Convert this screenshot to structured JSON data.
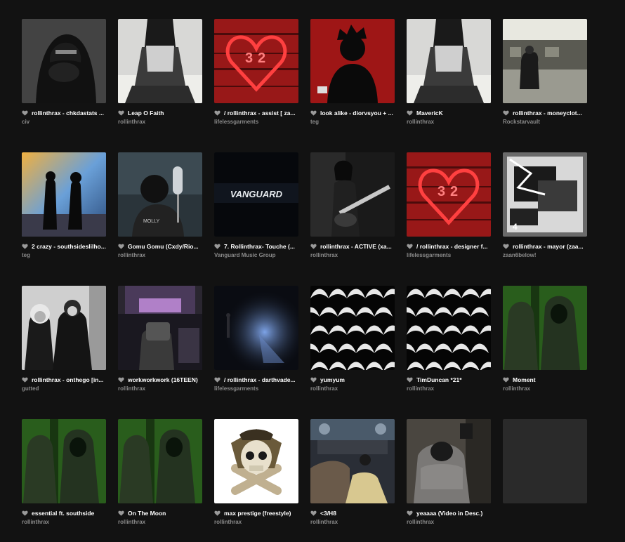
{
  "items": [
    {
      "title": "rollinthrax - chkdastats ...",
      "user": "civ",
      "art": "hooded-figure-photo"
    },
    {
      "title": "Leap O Faith",
      "user": "rollinthrax",
      "art": "figure-on-bed-photo"
    },
    {
      "title": "/ rollinthrax - assist [ za...",
      "user": "lifelessgarments",
      "art": "red-heart-collage"
    },
    {
      "title": "look alike - diorvsyou + ...",
      "user": "teg",
      "art": "red-silhouette-cover"
    },
    {
      "title": "MavericK",
      "user": "rollinthrax",
      "art": "figure-on-bed-photo"
    },
    {
      "title": "rollinthrax - moneyclot...",
      "user": "Rockstarvault",
      "art": "parking-garage-photo"
    },
    {
      "title": "2 crazy - southsideslilho...",
      "user": "teg",
      "art": "two-figures-sky-photo"
    },
    {
      "title": "Gomu Gomu (Cxdy/Rio...",
      "user": "rollinthrax",
      "art": "studio-microphone-photo"
    },
    {
      "title": "7. Rollinthrax- Touche (...",
      "user": "Vanguard Music Group",
      "art": "vanguard-logo-cover"
    },
    {
      "title": "rollinthrax - ACTIVE (xa...",
      "user": "rollinthrax",
      "art": "guitarist-photo"
    },
    {
      "title": "/ rollinthrax - designer f...",
      "user": "lifelessgarments",
      "art": "red-heart-collage"
    },
    {
      "title": "rollinthrax - mayor (zaa...",
      "user": "zaan6below!",
      "art": "grunge-glitch-cover"
    },
    {
      "title": "rollinthrax - onthego [in...",
      "user": "gutted",
      "art": "bw-duo-photo"
    },
    {
      "title": "workworkwork (16TEEN)",
      "user": "rollinthrax",
      "art": "gaming-setup-photo"
    },
    {
      "title": "/ rollinthrax - darthvade...",
      "user": "lifelessgarments",
      "art": "dark-stage-light-cover"
    },
    {
      "title": "yumyum",
      "user": "rollinthrax",
      "art": "black-white-pattern"
    },
    {
      "title": "TimDuncan *21*",
      "user": "rollinthrax",
      "art": "black-white-pattern"
    },
    {
      "title": "Moment",
      "user": "rollinthrax",
      "art": "green-hoodies-photo"
    },
    {
      "title": "essential ft. southside",
      "user": "rollinthrax",
      "art": "green-hoodies-photo"
    },
    {
      "title": "On The Moon",
      "user": "rollinthrax",
      "art": "green-hoodies-photo"
    },
    {
      "title": "max prestige (freestyle)",
      "user": "rollinthrax",
      "art": "skull-prestige-emblem"
    },
    {
      "title": "<3/H8",
      "user": "rollinthrax",
      "art": "car-interior-photo"
    },
    {
      "title": "yeaaaa (Video in Desc.)",
      "user": "rollinthrax",
      "art": "figure-in-chair-photo"
    },
    {
      "title": "",
      "user": "",
      "art": "empty-placeholder"
    }
  ]
}
